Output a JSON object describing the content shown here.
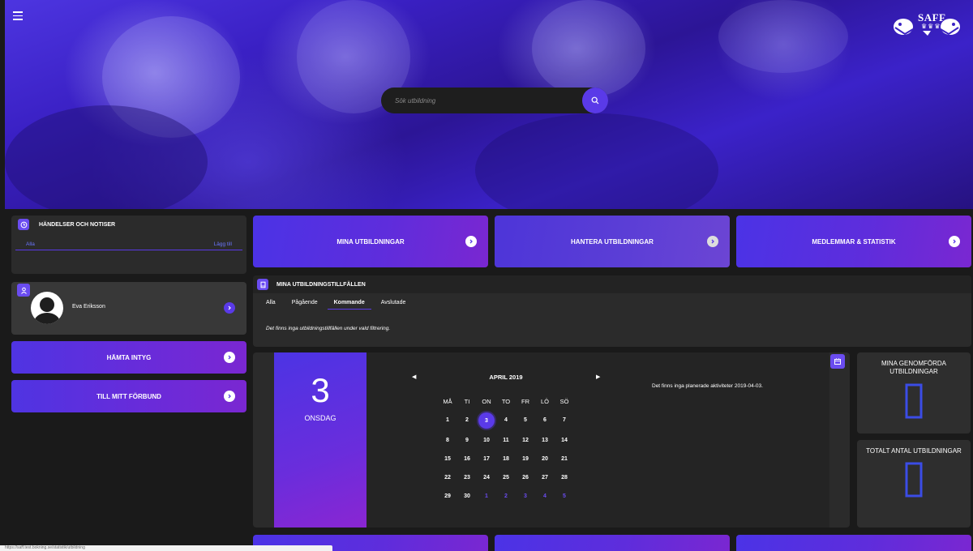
{
  "hero": {
    "search_placeholder": "Sök utbildning",
    "logo_text": "SAFF",
    "logo_crowns": "♛♛♛"
  },
  "events": {
    "title": "HÄNDELSER OCH NOTISER",
    "tab_all": "Alla",
    "tab_add": "Lägg till"
  },
  "user": {
    "name": "Eva Eriksson"
  },
  "actions": {
    "certificate": "HÄMTA INTYG",
    "federation": "TILL MITT FÖRBUND"
  },
  "nav": {
    "my_trainings": "MINA UTBILDNINGAR",
    "manage_trainings": "HANTERA UTBILDNINGAR",
    "members_stats": "MEDLEMMAR & STATISTIK"
  },
  "sessions": {
    "title": "MINA UTBILDNINGSTILLFÄLLEN",
    "tabs": [
      "Alla",
      "Pågående",
      "Kommande",
      "Avslutade"
    ],
    "active_tab": "Kommande",
    "empty_note": "Det finns inga utbildningstillfällen under vald filtrering."
  },
  "calendar": {
    "selected_day_number": "3",
    "selected_weekday": "ONSDAG",
    "month_label": "APRIL 2019",
    "weekdays": [
      "MÅ",
      "TI",
      "ON",
      "TO",
      "FR",
      "LÖ",
      "SÖ"
    ],
    "weeks": [
      [
        "1",
        "2",
        "3",
        "4",
        "5",
        "6",
        "7"
      ],
      [
        "8",
        "9",
        "10",
        "11",
        "12",
        "13",
        "14"
      ],
      [
        "15",
        "16",
        "17",
        "18",
        "19",
        "20",
        "21"
      ],
      [
        "22",
        "23",
        "24",
        "25",
        "26",
        "27",
        "28"
      ],
      [
        "29",
        "30",
        "1",
        "2",
        "3",
        "4",
        "5"
      ]
    ],
    "selected_date": "3",
    "no_activities": "Det finns inga planerade aktiviteter 2019-04-03."
  },
  "stats": {
    "completed_title": "MINA GENOMFÖRDA UTBILDNINGAR",
    "completed_value": 0,
    "total_title": "TOTALT ANTAL UTBILDNINGAR",
    "total_value": 0
  },
  "status_bar": {
    "url": "https://saff.test.bokning.se/statistik/utbildning"
  },
  "colors": {
    "accent": "#5a3ae8",
    "panel": "#2b2b2b",
    "background": "#1a1a1a",
    "digit": "#3b4ce6"
  }
}
